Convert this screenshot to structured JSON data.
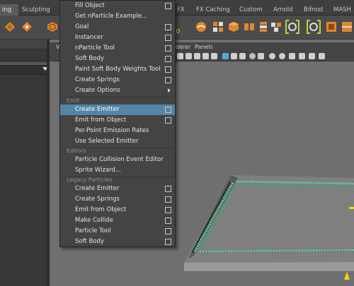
{
  "shelf_tabs": [
    {
      "label": "ing",
      "active": true
    },
    {
      "label": "Sculpting"
    },
    {
      "label": "FX"
    },
    {
      "label": "FX Caching"
    },
    {
      "label": "Custom"
    },
    {
      "label": "Arnold"
    },
    {
      "label": "Bifrost"
    },
    {
      "label": "MASH"
    }
  ],
  "shelf_value": "0.0",
  "viewport": {
    "menu_first": "V",
    "renderer_label": "derer",
    "panels_label": "Panels"
  },
  "menu": {
    "top_items": [
      {
        "label": "Fill Object"
      },
      {
        "label": "Get nParticle Example..."
      },
      {
        "label": "Goal"
      },
      {
        "label": "Instancer"
      },
      {
        "label": "nParticle Tool"
      },
      {
        "label": "Soft Body"
      },
      {
        "label": "Paint Soft Body Weights Tool"
      },
      {
        "label": "Create Springs"
      },
      {
        "label": "Create Options"
      }
    ],
    "emit_header": "Emit",
    "emit_items": [
      {
        "label": "Create Emitter"
      },
      {
        "label": "Emit from Object"
      },
      {
        "label": "Per-Point Emission Rates"
      },
      {
        "label": "Use Selected Emitter"
      }
    ],
    "editors_header": "Editors",
    "editor_items": [
      {
        "label": "Particle Collision Event Editor"
      },
      {
        "label": "Sprite Wizard..."
      }
    ],
    "legacy_header": "Legacy Particles",
    "legacy_items": [
      {
        "label": "Create Emitter"
      },
      {
        "label": "Create Springs"
      },
      {
        "label": "Emit from Object"
      },
      {
        "label": "Make Collide"
      },
      {
        "label": "Particle Tool"
      },
      {
        "label": "Soft Body"
      }
    ]
  },
  "colors": {
    "highlight": "#5285a6",
    "menu_bg": "#444444",
    "viewport_bg": "#6f6f6f",
    "accent_orange": "#e0862c",
    "particle_green": "#47e6a0"
  }
}
